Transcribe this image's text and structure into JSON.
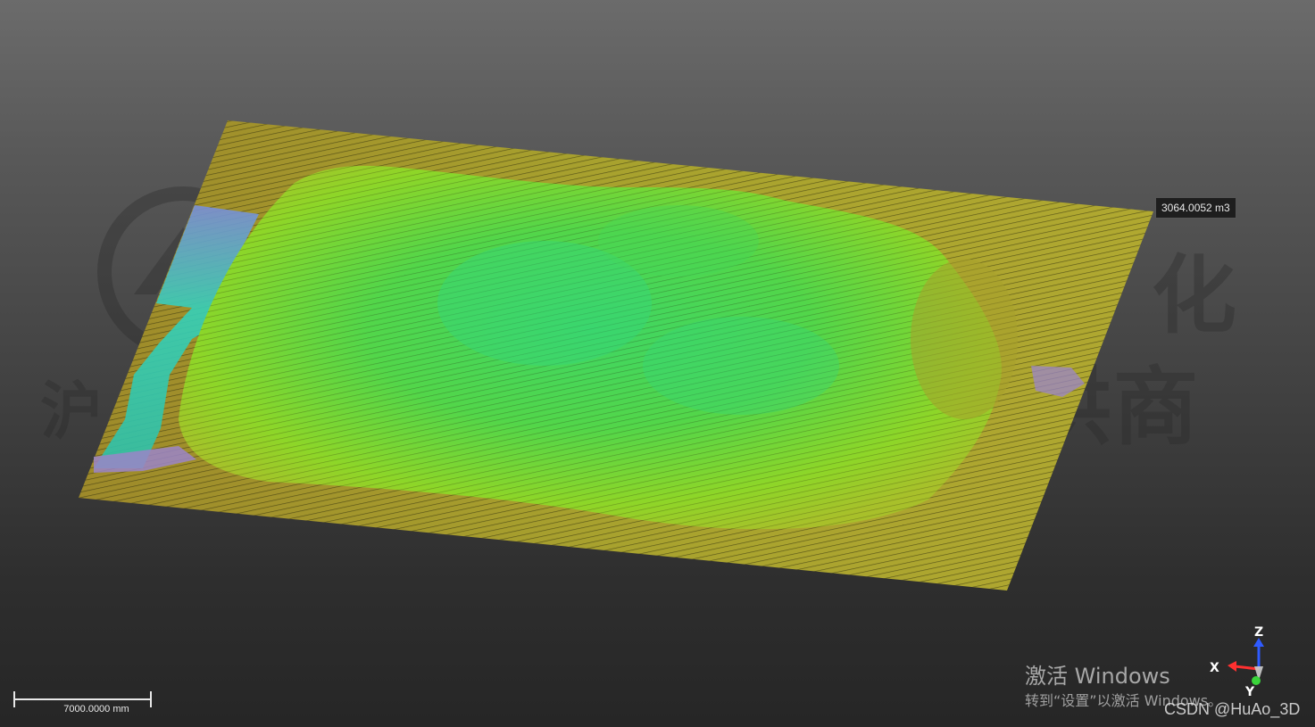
{
  "viewport": {
    "volume_label": "3064.0052 m3",
    "scale_bar_label": "7000.0000 mm"
  },
  "axis_triad": {
    "x": "X",
    "y": "Y",
    "z": "Z"
  },
  "watermark": {
    "top_right": "化",
    "right": "供商",
    "left": "沪"
  },
  "os_overlay": {
    "activate_title": "激活 Windows",
    "activate_sub": "转到“设置”以激活 Windows。"
  },
  "credit": "CSDN @HuAo_3D",
  "colors": {
    "plane": "#a8a22e",
    "terrain_high": "#3ed65a",
    "terrain_mid": "#8fd41e",
    "edge_cyan": "#35d0b8",
    "edge_purple": "#9b85c8"
  }
}
